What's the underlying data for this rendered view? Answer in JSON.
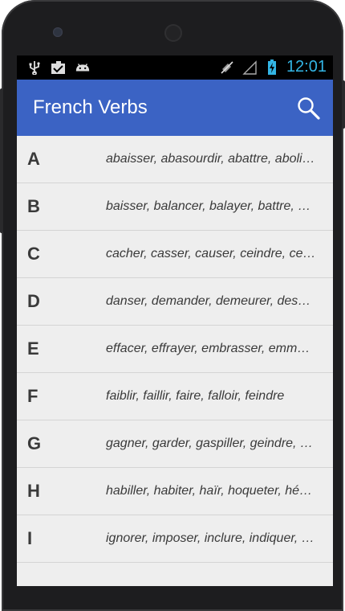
{
  "status_bar": {
    "time": "12:01",
    "icons": [
      "usb-icon",
      "clipboard-check-icon",
      "android-icon",
      "mute-icon",
      "signal-icon",
      "battery-charging-icon"
    ]
  },
  "app_bar": {
    "title": "French Verbs",
    "search_icon": "search-icon"
  },
  "colors": {
    "app_bar": "#3b63c4",
    "clock": "#33b5e5",
    "list_bg": "#eeeeee"
  },
  "rows": [
    {
      "letter": "A",
      "verbs": "abaisser, abasourdir, abattre, abolir, aboutir"
    },
    {
      "letter": "B",
      "verbs": "baisser, balancer, balayer, battre, bavarder"
    },
    {
      "letter": "C",
      "verbs": "cacher, casser, causer, ceindre, cesser"
    },
    {
      "letter": "D",
      "verbs": "danser, demander, demeurer, descendre"
    },
    {
      "letter": "E",
      "verbs": "effacer, effrayer, embrasser, emmener"
    },
    {
      "letter": "F",
      "verbs": "faiblir, faillir, faire, falloir, feindre"
    },
    {
      "letter": "G",
      "verbs": "gagner, garder, gaspiller, geindre, goûter"
    },
    {
      "letter": "H",
      "verbs": "habiller, habiter, haïr, hoqueter, hésiter"
    },
    {
      "letter": "I",
      "verbs": "ignorer, imposer, inclure, indiquer, inscrire"
    }
  ]
}
